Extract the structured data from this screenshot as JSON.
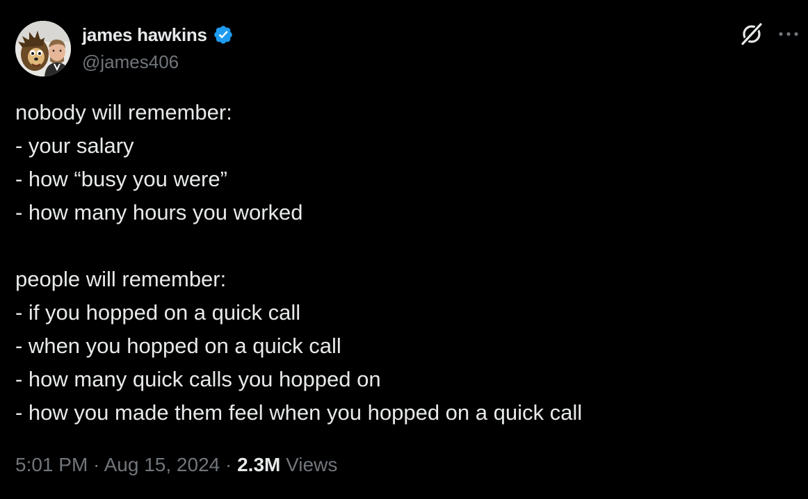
{
  "author": {
    "display_name": "james hawkins",
    "handle": "@james406",
    "verified": true,
    "verified_color": "#1d9bf0"
  },
  "actions": {
    "grok_icon": "grok-icon",
    "more_icon": "more-horizontal-icon"
  },
  "tweet": {
    "lines": [
      "nobody will remember:",
      "- your salary",
      "- how “busy you were”",
      "- how many hours you worked",
      "",
      "people will remember:",
      "- if you hopped on a quick call",
      "- when you hopped on a quick call",
      "- how many quick calls you hopped on",
      "- how you made them feel when you hopped on a quick call"
    ]
  },
  "meta": {
    "time": "5:01 PM",
    "separator": " · ",
    "date": "Aug 15, 2024",
    "views_count": "2.3M",
    "views_label": " Views"
  },
  "colors": {
    "background": "#000000",
    "text_primary": "#e7e9ea",
    "text_secondary": "#71767b"
  }
}
